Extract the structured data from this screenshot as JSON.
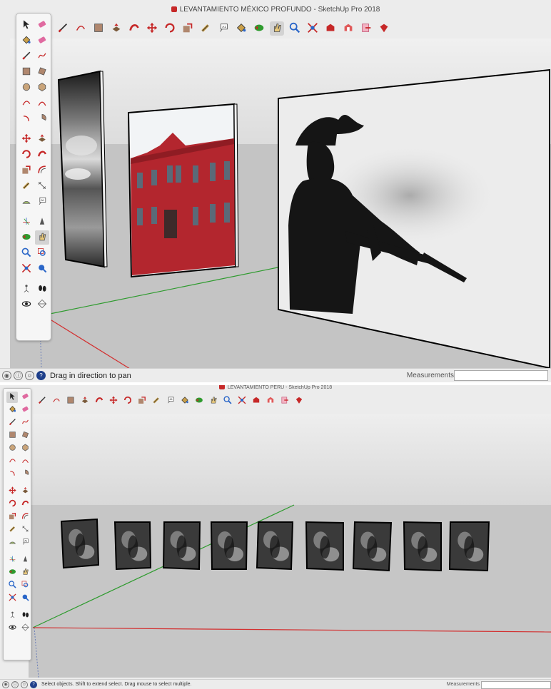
{
  "windows": [
    {
      "id": "mexico",
      "title": "LEVANTAMIENTO MÉXICO PROFUNDO - SketchUp Pro 2018",
      "status_text": "Drag in direction to pan",
      "measurements_label": "Measurements",
      "measurements_value": "",
      "active_tool": "pan-icon",
      "panels": [
        {
          "name": "panel-clouds",
          "depicts": "black and white photograph of clouds over water"
        },
        {
          "name": "panel-red-building",
          "depicts": "colour photograph of a red colonial building facade"
        },
        {
          "name": "panel-cowboy-rifle",
          "depicts": "black and white silhouette of a man in a hat holding a rifle"
        }
      ]
    },
    {
      "id": "peru",
      "title": "LEVANTAMIENTO PERU - SketchUp Pro 2018",
      "status_text": "Select objects. Shift to extend select. Drag mouse to select multiple.",
      "measurements_label": "Measurements",
      "measurements_value": "",
      "active_tool": "select-icon",
      "panels": [
        {
          "name": "photo-ruins",
          "depicts": "stone ruins"
        },
        {
          "name": "photo-doorway",
          "depicts": "stone doorway"
        },
        {
          "name": "photo-portrait-man",
          "depicts": "portrait of a man"
        },
        {
          "name": "photo-hands",
          "depicts": "hands holding objects"
        },
        {
          "name": "photo-musicians",
          "depicts": "musicians playing brass instruments"
        },
        {
          "name": "photo-woman-child",
          "depicts": "woman carrying a child"
        },
        {
          "name": "photo-crowd",
          "depicts": "crowd at a festival"
        },
        {
          "name": "photo-street",
          "depicts": "narrow cobbled street"
        },
        {
          "name": "photo-women-street",
          "depicts": "women walking in a street"
        }
      ]
    }
  ],
  "toolbar_icons": [
    "line-icon",
    "arc-icon",
    "rectangle-icon",
    "push-pull-icon",
    "follow-me-icon",
    "move-icon",
    "rotate-icon",
    "scale-icon",
    "tape-measure-icon",
    "text-icon",
    "paint-bucket-icon",
    "orbit-icon",
    "pan-icon",
    "zoom-icon",
    "zoom-extents-icon",
    "warehouse-icon",
    "extension-warehouse-icon",
    "send-to-layout-icon",
    "ruby-icon"
  ],
  "palette_icons": [
    "select-icon",
    "eraser-icon",
    "paint-bucket-icon",
    "eraser-alt-icon",
    "line-icon",
    "freehand-icon",
    "rectangle-icon",
    "rotated-rectangle-icon",
    "circle-icon",
    "polygon-icon",
    "arc-icon",
    "two-point-arc-icon",
    "three-point-arc-icon",
    "pie-icon",
    "move-icon",
    "push-pull-icon",
    "rotate-icon",
    "follow-me-icon",
    "scale-icon",
    "offset-icon",
    "tape-measure-icon",
    "dimension-icon",
    "protractor-icon",
    "text-icon",
    "axes-icon",
    "3d-text-icon",
    "orbit-icon",
    "pan-icon",
    "zoom-icon",
    "zoom-window-icon",
    "zoom-extents-icon",
    "previous-view-icon",
    "position-camera-icon",
    "walk-icon",
    "look-around-icon",
    "section-plane-icon"
  ],
  "colors": {
    "sky_top": "#e6e6e6",
    "sky_bottom": "#d0d0d0",
    "ground": "#c4c4c4",
    "axis_red": "#d32f2f",
    "axis_green": "#2e9b2e",
    "axis_blue": "#6b7fb8",
    "building_red": "#b3262e",
    "tool_red": "#c62828",
    "highlight": "#d3d3d3"
  }
}
